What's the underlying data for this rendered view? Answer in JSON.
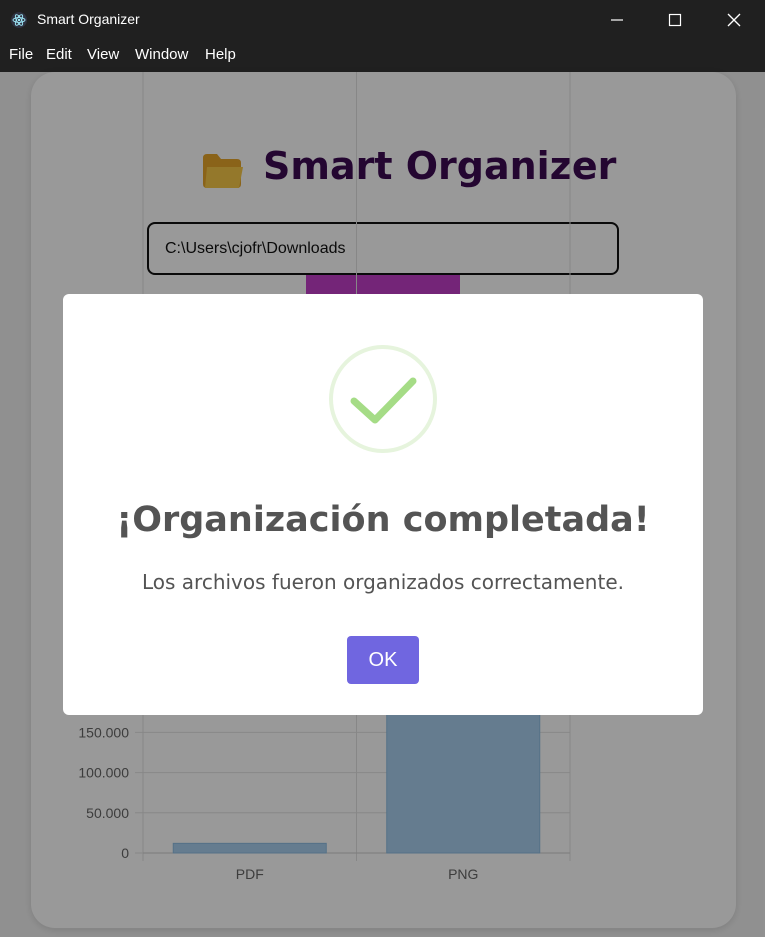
{
  "window": {
    "title": "Smart Organizer",
    "icon": "electron-atom-icon",
    "controls": [
      "minimize-icon",
      "maximize-icon",
      "close-icon"
    ]
  },
  "menu": [
    "File",
    "Edit",
    "View",
    "Window",
    "Help"
  ],
  "app": {
    "title": "Smart Organizer",
    "title_icon": "folder-icon",
    "path_value": "C:\\Users\\cjofr\\Downloads",
    "accent_color": "#c23ec9",
    "title_color": "#3d0a52"
  },
  "chart_data": {
    "type": "bar",
    "categories": [
      "PDF",
      "PNG"
    ],
    "values": [
      12000,
      200000
    ],
    "yticks": [
      "0",
      "50.000",
      "100.000",
      "150.000"
    ],
    "ylim": [
      0,
      200000
    ],
    "grid": true,
    "bar_color": "#a8cfee"
  },
  "modal": {
    "icon": "success-check-icon",
    "title": "¡Organización completada!",
    "text": "Los archivos fueron organizados correctamente.",
    "ok_label": "OK",
    "button_color": "#7066e0"
  }
}
